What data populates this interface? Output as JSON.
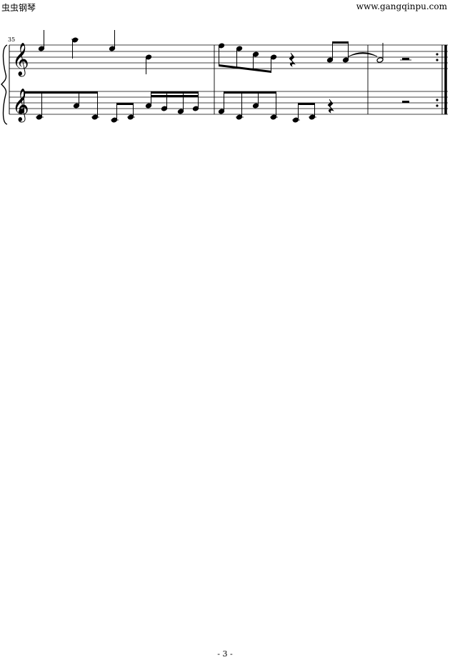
{
  "header": {
    "site_name": "虫虫钢琴",
    "site_url": "www.gangqinpu.com"
  },
  "score": {
    "measure_number": "35"
  },
  "footer": {
    "page_number": "- 3 -"
  }
}
